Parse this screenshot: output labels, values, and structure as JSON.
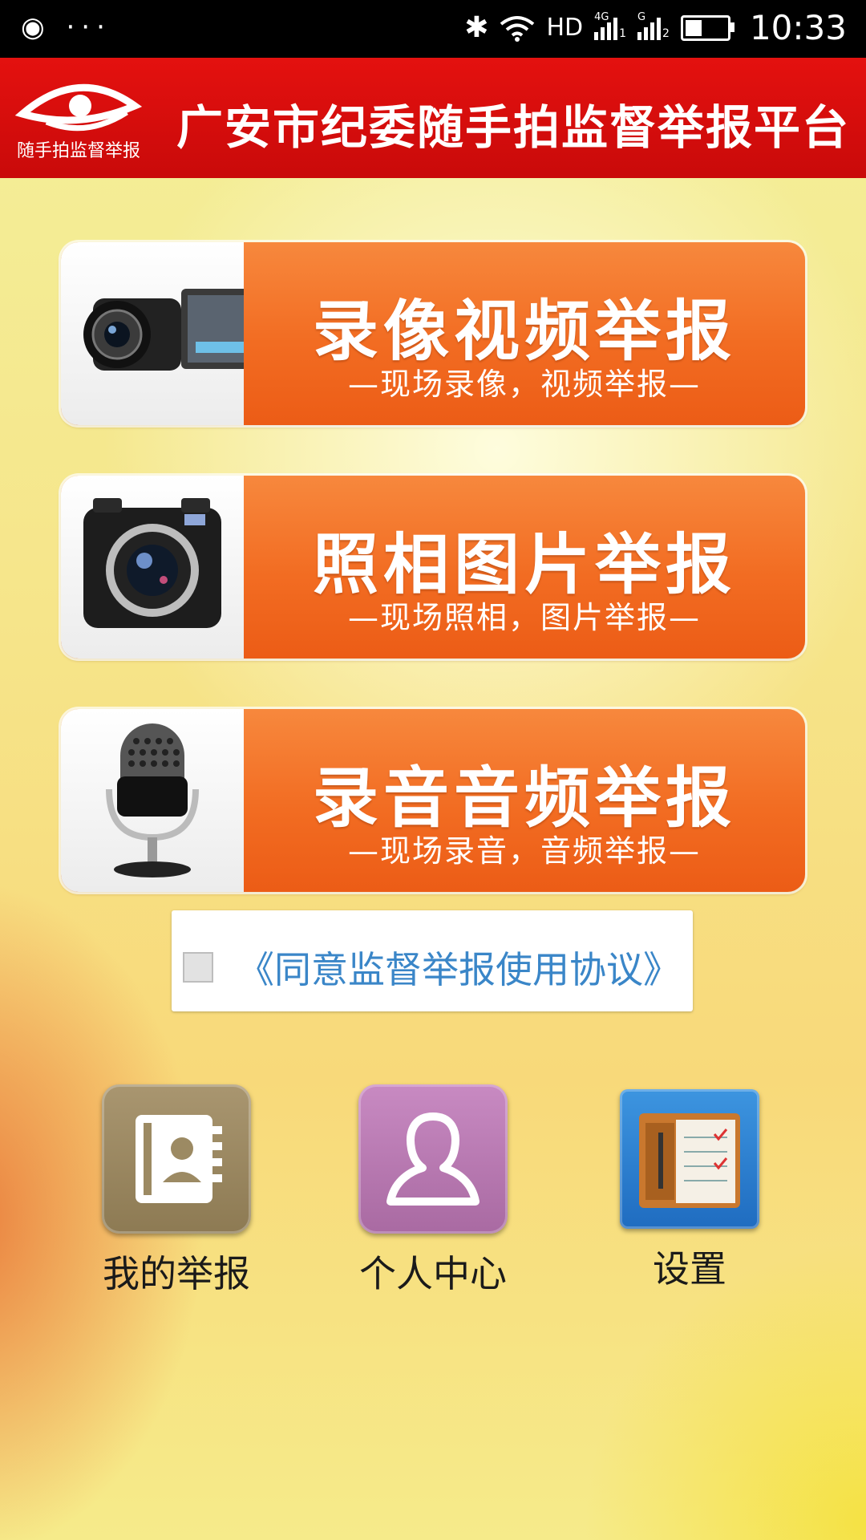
{
  "status_bar": {
    "time": "10:33",
    "left_icons": [
      "record-icon",
      "more-icon"
    ],
    "right_icons": [
      "bluetooth-icon",
      "wifi-icon",
      "signal-icon",
      "signal-icon",
      "battery-icon"
    ],
    "network_labels": [
      "HD",
      "4G",
      "1",
      "G",
      "2"
    ],
    "battery_level": 0.4
  },
  "header": {
    "title": "广安市纪委随手拍监督举报平台",
    "logo_text": "随手拍监督举报",
    "colors": {
      "background": "#d90d0d"
    }
  },
  "reports": [
    {
      "title": "录像视频举报",
      "subtitle": "—现场录像，视频举报—",
      "icon": "video-camera-icon"
    },
    {
      "title": "照相图片举报",
      "subtitle": "—现场照相，图片举报—",
      "icon": "camera-icon"
    },
    {
      "title": "录音音频举报",
      "subtitle": "—现场录音，音频举报—",
      "icon": "microphone-icon"
    }
  ],
  "agreement": {
    "checked": false,
    "link_text": "《同意监督举报使用协议》"
  },
  "bottom_nav": [
    {
      "label": "我的举报",
      "icon": "contact-book-icon",
      "color": "#9c8a63"
    },
    {
      "label": "个人中心",
      "icon": "user-profile-icon",
      "color": "#b97bb2"
    },
    {
      "label": "设置",
      "icon": "organizer-icon",
      "color": "#2e7fd0"
    }
  ],
  "colors": {
    "button_orange": "#f26c22",
    "link_blue": "#3a86c8"
  }
}
